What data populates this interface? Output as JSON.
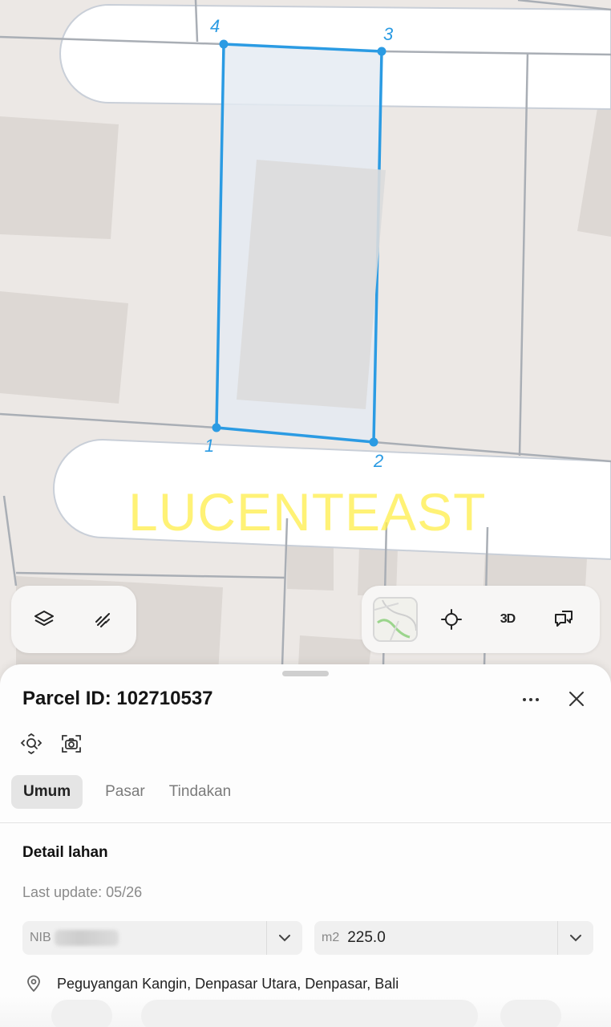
{
  "map": {
    "parcel_vertices": [
      "1",
      "2",
      "3",
      "4"
    ],
    "watermark": "LUCENTEAST",
    "colors": {
      "parcel_outline": "#2b9be3",
      "parcel_fill": "#e6ecf2",
      "road": "#ffffff",
      "ground": "#ece8e5",
      "building": "#ddd8d4",
      "boundary_line": "#a9aeb5"
    }
  },
  "controls": {
    "left": [
      {
        "icon": "layers-icon"
      },
      {
        "icon": "measure-icon"
      }
    ],
    "right": [
      {
        "icon": "basemap-thumbnail"
      },
      {
        "icon": "locate-icon"
      },
      {
        "label": "3D"
      },
      {
        "icon": "feedback-icon"
      }
    ]
  },
  "sheet": {
    "title": "Parcel ID: 102710537",
    "actions": [
      "more-icon",
      "close-icon"
    ],
    "tools": [
      "zoom-to-parcel-icon",
      "screenshot-icon"
    ],
    "tabs": [
      {
        "label": "Umum",
        "active": true
      },
      {
        "label": "Pasar",
        "active": false
      },
      {
        "label": "Tindakan",
        "active": false
      }
    ],
    "section_title": "Detail lahan",
    "last_update": "Last update: 05/26",
    "nib": {
      "prefix": "NIB",
      "value": ""
    },
    "area": {
      "prefix": "m2",
      "value": "225.0"
    },
    "address": "Peguyangan Kangin, Denpasar Utara, Denpasar, Bali"
  }
}
